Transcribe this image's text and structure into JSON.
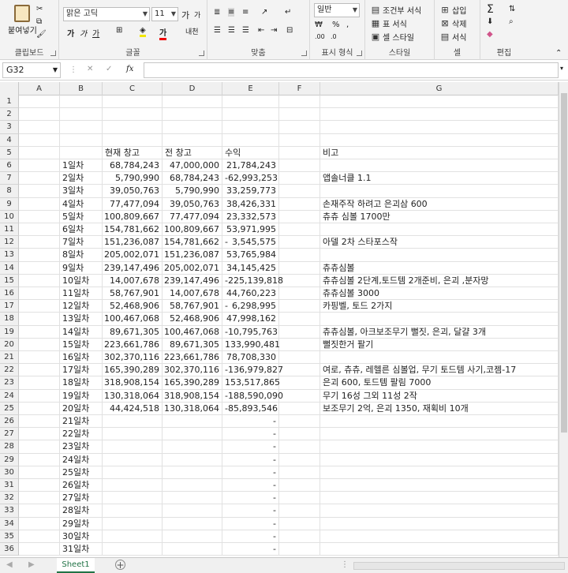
{
  "ribbon": {
    "clipboard": {
      "paste": "붙여넣기",
      "label": "클립보드"
    },
    "font": {
      "name": "맑은 고딕",
      "size": "11",
      "grow": "가",
      "shrink": "가",
      "bold": "가",
      "italic": "가",
      "underline": "가",
      "label": "글꼴"
    },
    "align": {
      "label": "맞춤"
    },
    "number": {
      "format": "일반",
      "label": "표시 형식",
      "percent": "%"
    },
    "styles": {
      "cond": "조건부 서식",
      "table": "표 서식",
      "cell": "셀 스타일",
      "label": "스타일"
    },
    "cells": {
      "insert": "삽입",
      "delete": "삭제",
      "format": "서식",
      "label": "셀"
    },
    "edit": {
      "label": "편집"
    }
  },
  "formula": {
    "namebox": "G32",
    "fx": "fx",
    "value": ""
  },
  "columns": [
    "A",
    "B",
    "C",
    "D",
    "E",
    "F",
    "G"
  ],
  "headers": {
    "current": "현재 창고",
    "prev": "전 창고",
    "profit": "수익",
    "note": "비고"
  },
  "rows": [
    {
      "n": "1"
    },
    {
      "n": "2"
    },
    {
      "n": "3"
    },
    {
      "n": "4"
    },
    {
      "n": "5",
      "header": true
    },
    {
      "n": "6",
      "day": "1일차",
      "cur": "68,784,243",
      "prev": "47,000,000",
      "sign": "",
      "profit": "21,784,243",
      "note": ""
    },
    {
      "n": "7",
      "day": "2일차",
      "cur": "5,790,990",
      "prev": "68,784,243",
      "sign": "-",
      "profit": "62,993,253",
      "note": "앱솔너클 1.1"
    },
    {
      "n": "8",
      "day": "3일차",
      "cur": "39,050,763",
      "prev": "5,790,990",
      "sign": "",
      "profit": "33,259,773",
      "note": ""
    },
    {
      "n": "9",
      "day": "4일차",
      "cur": "77,477,094",
      "prev": "39,050,763",
      "sign": "",
      "profit": "38,426,331",
      "note": "손재주작 하려고 은괴삼 600"
    },
    {
      "n": "10",
      "day": "5일차",
      "cur": "100,809,667",
      "prev": "77,477,094",
      "sign": "",
      "profit": "23,332,573",
      "note": "츄츄 심볼 1700만"
    },
    {
      "n": "11",
      "day": "6일차",
      "cur": "154,781,662",
      "prev": "100,809,667",
      "sign": "",
      "profit": "53,971,995",
      "note": ""
    },
    {
      "n": "12",
      "day": "7일차",
      "cur": "151,236,087",
      "prev": "154,781,662",
      "sign": "-",
      "profit": "3,545,575",
      "note": "아델 2차 스타포스작"
    },
    {
      "n": "13",
      "day": "8일차",
      "cur": "205,002,071",
      "prev": "151,236,087",
      "sign": "",
      "profit": "53,765,984",
      "note": ""
    },
    {
      "n": "14",
      "day": "9일차",
      "cur": "239,147,496",
      "prev": "205,002,071",
      "sign": "",
      "profit": "34,145,425",
      "note": "츄츄심볼"
    },
    {
      "n": "15",
      "day": "10일차",
      "cur": "14,007,678",
      "prev": "239,147,496",
      "sign": "",
      "profit": "-225,139,818",
      "note": "츄츄심볼 2단계,토드템 2개준비, 은괴 ,분자망"
    },
    {
      "n": "16",
      "day": "11일차",
      "cur": "58,767,901",
      "prev": "14,007,678",
      "sign": "",
      "profit": "44,760,223",
      "note": "츄츄심볼 3000"
    },
    {
      "n": "17",
      "day": "12일차",
      "cur": "52,468,906",
      "prev": "58,767,901",
      "sign": "-",
      "profit": "6,298,995",
      "note": "카핑벨, 토드 2가지"
    },
    {
      "n": "18",
      "day": "13일차",
      "cur": "100,467,068",
      "prev": "52,468,906",
      "sign": "",
      "profit": "47,998,162",
      "note": ""
    },
    {
      "n": "19",
      "day": "14일차",
      "cur": "89,671,305",
      "prev": "100,467,068",
      "sign": "-",
      "profit": "10,795,763",
      "note": "츄츄심볼, 아크보조무기 뻘짓, 은괴, 달걀 3개"
    },
    {
      "n": "20",
      "day": "15일차",
      "cur": "223,661,786",
      "prev": "89,671,305",
      "sign": "",
      "profit": "133,990,481",
      "note": "뻘짓한거 팔기"
    },
    {
      "n": "21",
      "day": "16일차",
      "cur": "302,370,116",
      "prev": "223,661,786",
      "sign": "",
      "profit": "78,708,330",
      "note": ""
    },
    {
      "n": "22",
      "day": "17일차",
      "cur": "165,390,289",
      "prev": "302,370,116",
      "sign": "",
      "profit": "-136,979,827",
      "note": "여로, 츄츄, 레헬른 심볼업, 무기 토드템 사기,코젬-17"
    },
    {
      "n": "23",
      "day": "18일차",
      "cur": "318,908,154",
      "prev": "165,390,289",
      "sign": "",
      "profit": "153,517,865",
      "note": "은괴 600, 토드템 팔림 7000"
    },
    {
      "n": "24",
      "day": "19일차",
      "cur": "130,318,064",
      "prev": "318,908,154",
      "sign": "",
      "profit": "-188,590,090",
      "note": "무기 16성 그외 11성 2작"
    },
    {
      "n": "25",
      "day": "20일차",
      "cur": "44,424,518",
      "prev": "130,318,064",
      "sign": "-",
      "profit": "85,893,546",
      "note": "보조무기 2억, 은괴 1350, 재획비 10개"
    },
    {
      "n": "26",
      "day": "21일차",
      "dash": "-"
    },
    {
      "n": "27",
      "day": "22일차",
      "dash": "-"
    },
    {
      "n": "28",
      "day": "23일차",
      "dash": "-"
    },
    {
      "n": "29",
      "day": "24일차",
      "dash": "-"
    },
    {
      "n": "30",
      "day": "25일차",
      "dash": "-"
    },
    {
      "n": "31",
      "day": "26일차",
      "dash": "-"
    },
    {
      "n": "32",
      "day": "27일차",
      "dash": "-"
    },
    {
      "n": "33",
      "day": "28일차",
      "dash": "-"
    },
    {
      "n": "34",
      "day": "29일차",
      "dash": "-"
    },
    {
      "n": "35",
      "day": "30일차",
      "dash": "-"
    },
    {
      "n": "36",
      "day": "31일차",
      "dash": "-"
    }
  ],
  "sheet": {
    "tab": "Sheet1",
    "add": "+"
  }
}
